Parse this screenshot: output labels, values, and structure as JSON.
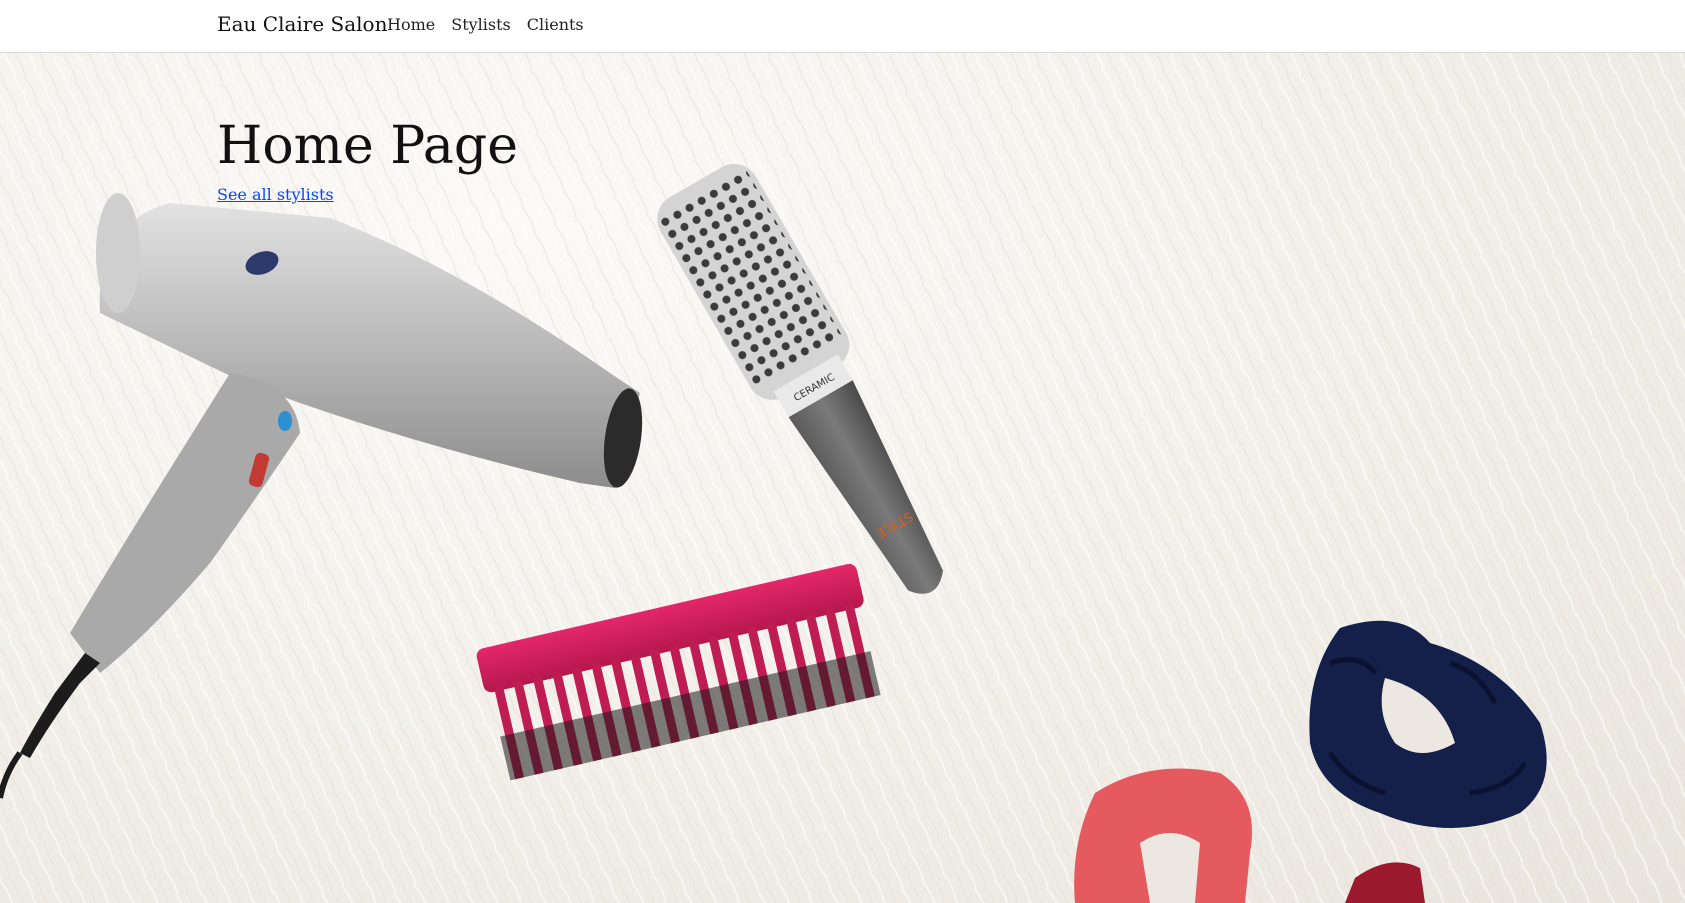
{
  "navbar": {
    "brand": "Eau Claire Salon",
    "links": [
      "Home",
      "Stylists",
      "Clients"
    ]
  },
  "main": {
    "title": "Home Page",
    "stylists_link": "See all stylists"
  },
  "hero_image": {
    "brush_label": "CERAMIC",
    "brush_handle_text": "STYLE",
    "colors": {
      "comb": "#d81e5b",
      "scrunchie_navy": "#14204a",
      "scrunchie_coral": "#e45a5e",
      "dryer": "#b8b8b8",
      "link": "#0645ff"
    }
  }
}
